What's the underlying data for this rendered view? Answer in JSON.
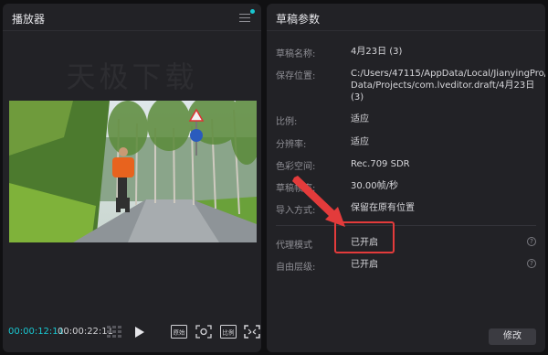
{
  "player": {
    "title": "播放器",
    "watermark": "天极下载",
    "time_current": "00:00:12:11",
    "time_total": "00:00:22:11",
    "icons": [
      "menu-icon",
      "grid-icon",
      "play-icon",
      "original-ratio-icon",
      "fit-icon",
      "ratio-icon",
      "fullscreen-icon"
    ],
    "buttons": {
      "original_label": "原始",
      "ratio_label": "比例"
    }
  },
  "props": {
    "title": "草稿参数",
    "rows": [
      {
        "label": "草稿名称:",
        "value": "4月23日 (3)"
      },
      {
        "label": "保存位置:",
        "value": "C:/Users/47115/AppData/Local/JianyingPro/User Data/Projects/com.lveditor.draft/4月23日 (3)"
      },
      {
        "label": "比例:",
        "value": "适应"
      },
      {
        "label": "分辨率:",
        "value": "适应"
      },
      {
        "label": "色彩空间:",
        "value": "Rec.709 SDR"
      },
      {
        "label": "草稿帧率:",
        "value": "30.00帧/秒"
      },
      {
        "label": "导入方式:",
        "value": "保留在原有位置"
      },
      {
        "label": "代理模式",
        "value": "已开启"
      },
      {
        "label": "自由层级:",
        "value": "已开启"
      }
    ],
    "modify_label": "修改"
  },
  "colors": {
    "accent": "#19c6d0",
    "annotation": "#e33b3b",
    "panel": "#222226",
    "background": "#101012"
  }
}
